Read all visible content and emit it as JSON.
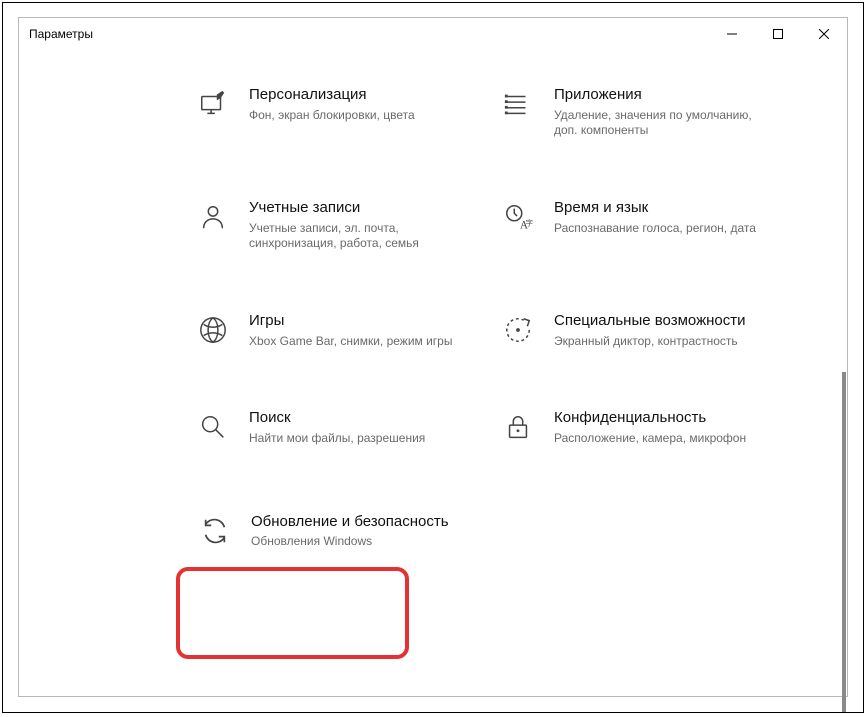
{
  "window": {
    "title": "Параметры"
  },
  "tiles": {
    "pers": {
      "title": "Персонализация",
      "desc": "Фон, экран блокировки, цвета"
    },
    "apps": {
      "title": "Приложения",
      "desc": "Удаление, значения по умолчанию, доп. компоненты"
    },
    "accounts": {
      "title": "Учетные записи",
      "desc": "Учетные записи, эл. почта, синхронизация, работа, семья"
    },
    "time": {
      "title": "Время и язык",
      "desc": "Распознавание голоса, регион, дата"
    },
    "gaming": {
      "title": "Игры",
      "desc": "Xbox Game Bar, снимки, режим игры"
    },
    "ease": {
      "title": "Специальные возможности",
      "desc": "Экранный диктор, контрастность"
    },
    "search": {
      "title": "Поиск",
      "desc": "Найти мои файлы, разрешения"
    },
    "privacy": {
      "title": "Конфиденциальность",
      "desc": "Расположение, камера, микрофон"
    },
    "update": {
      "title": "Обновление и безопасность",
      "desc": "Обновления Windows"
    }
  }
}
